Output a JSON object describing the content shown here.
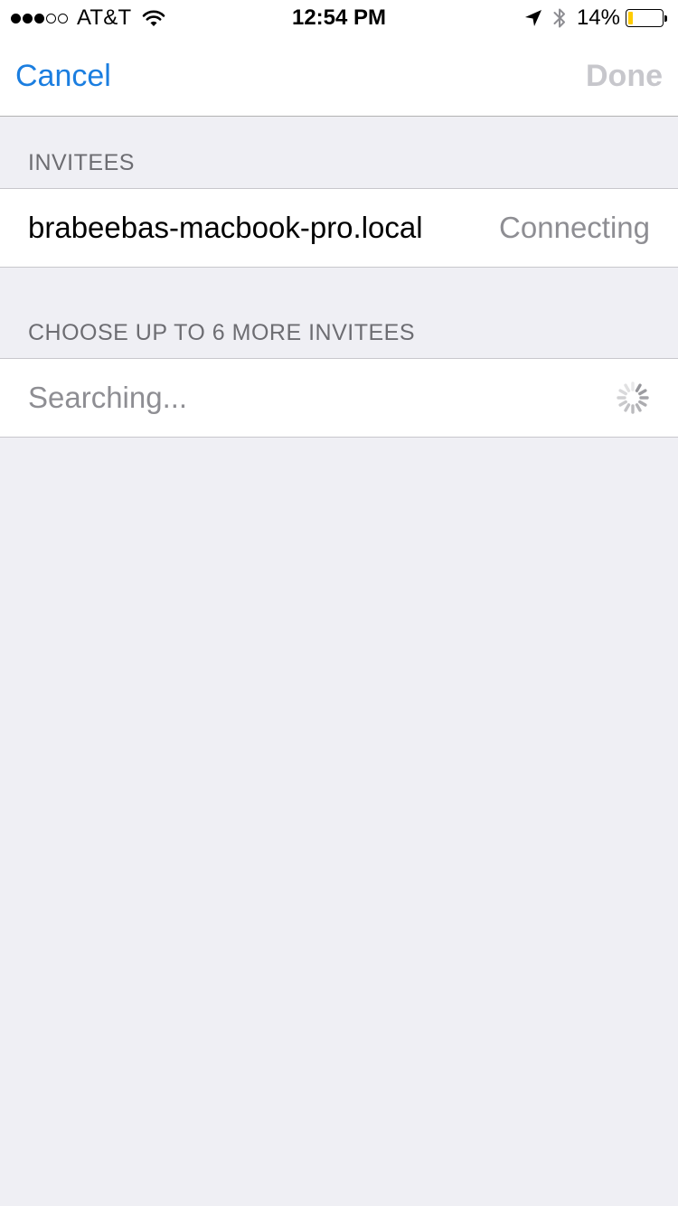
{
  "status_bar": {
    "signal_dots_filled": 3,
    "signal_dots_total": 5,
    "carrier": "AT&T",
    "time": "12:54 PM",
    "battery_percent": "14%",
    "battery_level": 0.14,
    "battery_color": "#ffcc00",
    "icons": [
      "wifi-icon",
      "location-arrow-icon",
      "bluetooth-icon",
      "battery-icon"
    ]
  },
  "nav": {
    "cancel_label": "Cancel",
    "done_label": "Done",
    "accent_color": "#1b7ee0",
    "disabled_color": "#c7c7cc"
  },
  "sections": {
    "invitees_header": "INVITEES",
    "invitees": [
      {
        "name": "brabeebas-macbook-pro.local",
        "status": "Connecting"
      }
    ],
    "choose_header": "CHOOSE UP TO 6 MORE INVITEES",
    "search_placeholder": "Searching...",
    "search_icon": "activity-spinner-icon"
  }
}
